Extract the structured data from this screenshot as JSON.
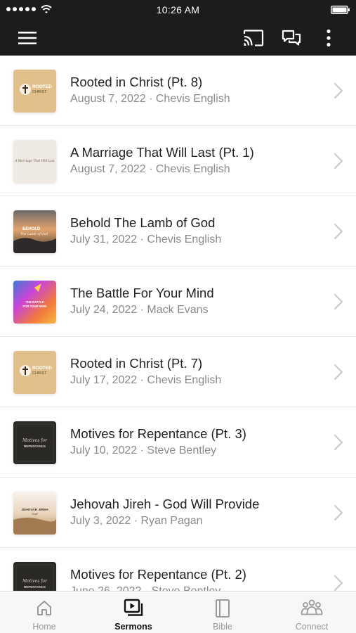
{
  "status_bar": {
    "time": "10:26 AM"
  },
  "nav": {
    "menu_icon": "hamburger-menu-icon",
    "cast_icon": "cast-icon",
    "chat_icon": "chat-bubbles-icon",
    "more_icon": "more-vertical-icon"
  },
  "sermons": [
    {
      "title": "Rooted in Christ (Pt. 8)",
      "meta": "August 7, 2022 · Chevis English",
      "thumb": "rooted",
      "thumb_text": "ROOTED CHRIST"
    },
    {
      "title": "A Marriage That Will Last (Pt. 1)",
      "meta": "August 7, 2022 · Chevis English",
      "thumb": "marriage",
      "thumb_text": "A Marriage That Will Last"
    },
    {
      "title": "Behold The Lamb of God",
      "meta": "July 31, 2022 · Chevis English",
      "thumb": "behold",
      "thumb_text": "BEHOLD The Lamb of God"
    },
    {
      "title": "The Battle For Your Mind",
      "meta": "July 24, 2022 · Mack Evans",
      "thumb": "battle",
      "thumb_text": "THE BATTLE FOR YOUR MIND"
    },
    {
      "title": "Rooted in Christ (Pt. 7)",
      "meta": "July 17, 2022 · Chevis English",
      "thumb": "rooted",
      "thumb_text": "ROOTED CHRIST"
    },
    {
      "title": "Motives for Repentance (Pt. 3)",
      "meta": "July 10, 2022 · Steve Bentley",
      "thumb": "motives",
      "thumb_text": "Motives for REPENTANCE"
    },
    {
      "title": "Jehovah Jireh - God Will Provide",
      "meta": "July 3, 2022 · Ryan Pagan",
      "thumb": "jireh",
      "thumb_text": "JEHOVAH JIREH God"
    },
    {
      "title": "Motives for Repentance (Pt. 2)",
      "meta": "June 26, 2022 · Steve Bentley",
      "thumb": "motives",
      "thumb_text": "Motives for REPENTANCE"
    }
  ],
  "tabs": [
    {
      "label": "Home",
      "icon": "home-icon",
      "active": false
    },
    {
      "label": "Sermons",
      "icon": "video-play-icon",
      "active": true
    },
    {
      "label": "Bible",
      "icon": "book-icon",
      "active": false
    },
    {
      "label": "Connect",
      "icon": "people-group-icon",
      "active": false
    }
  ],
  "colors": {
    "bar_bg": "#1c1c1c",
    "title_text": "#222222",
    "meta_text": "#8a8a8a",
    "tab_inactive": "#9a9a9a",
    "tab_active": "#111111"
  }
}
